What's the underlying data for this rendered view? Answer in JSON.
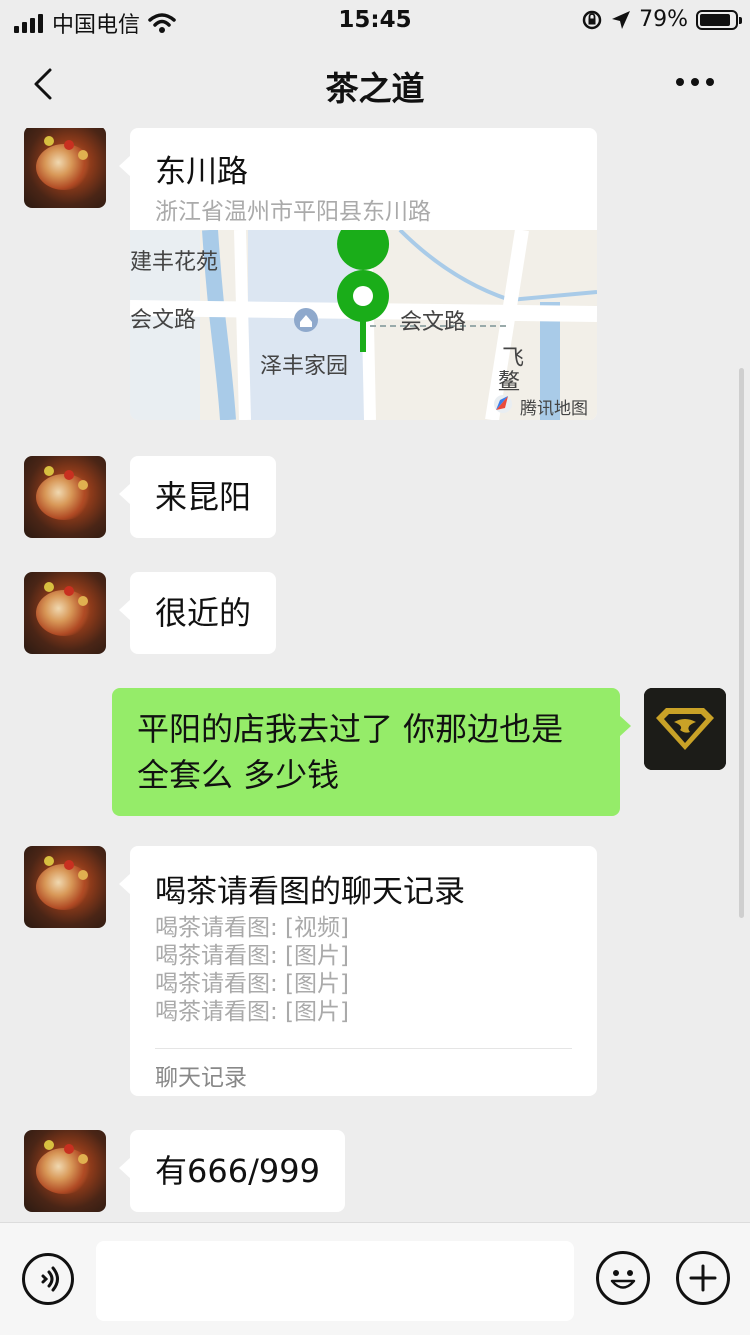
{
  "status_bar": {
    "carrier": "中国电信",
    "time": "15:45",
    "battery_percent": "79%",
    "battery_level": 0.79
  },
  "nav": {
    "title": "茶之道"
  },
  "messages": {
    "location": {
      "name": "东川路",
      "address": "浙江省温州市平阳县东川路",
      "map_labels": {
        "label1": "建丰花苑",
        "label2": "会文路",
        "label3": "会文路",
        "label4": "泽丰家园",
        "label5": "飞",
        "label6": "鳌",
        "provider": "腾讯地图"
      }
    },
    "m1": "来昆阳",
    "m2": "很近的",
    "m3_line1": "平阳的店我去过了 你那边也是",
    "m3_line2": "全套么 多少钱",
    "record": {
      "title": "喝茶请看图的聊天记录",
      "lines": [
        "喝茶请看图: [视频]",
        "喝茶请看图: [图片]",
        "喝茶请看图: [图片]",
        "喝茶请看图: [图片]"
      ],
      "footer": "聊天记录"
    },
    "m5": "有666/999"
  },
  "input": {
    "placeholder": ""
  },
  "colors": {
    "background": "#ededed",
    "sent_bubble": "#95ec69",
    "received_bubble": "#ffffff",
    "map_pin": "#1aad19"
  },
  "icons": {
    "back": "chevron-left-icon",
    "more": "more-icon",
    "voice": "voice-icon",
    "emoji": "emoji-icon",
    "add": "plus-icon"
  }
}
